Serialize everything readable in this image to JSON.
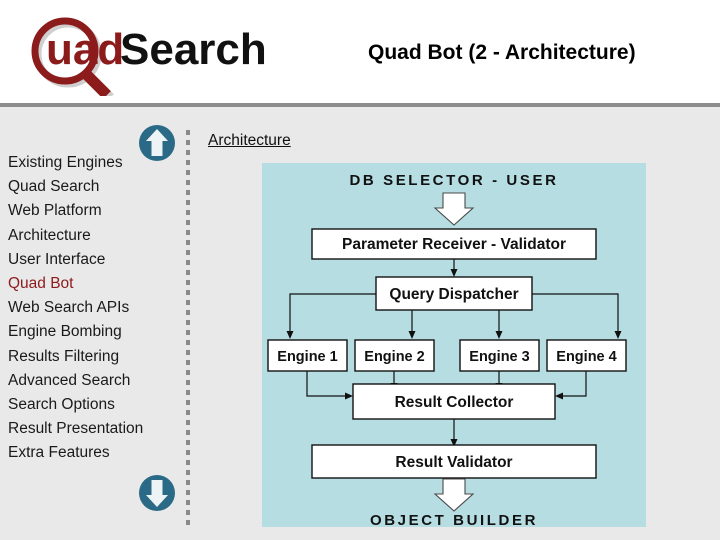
{
  "header": {
    "logo": {
      "icon": "magnifier-q-icon",
      "text_accent": "uad",
      "text_main": "Search",
      "accent_color": "#8c1b1b",
      "main_color": "#111111"
    },
    "title": "Quad Bot (2 - Architecture)"
  },
  "sidebar": {
    "scroll_up_icon": "circle-up-arrow-icon",
    "scroll_down_icon": "circle-down-arrow-icon",
    "accent_color": "#2a6a86",
    "active_color": "#8c1b1b",
    "items": [
      {
        "label": "Existing Engines",
        "active": false
      },
      {
        "label": "Quad Search",
        "active": false
      },
      {
        "label": "Web Platform",
        "active": false
      },
      {
        "label": "Architecture",
        "active": false
      },
      {
        "label": "User Interface",
        "active": false
      },
      {
        "label": "Quad Bot",
        "active": true
      },
      {
        "label": "Web Search APIs",
        "active": false
      },
      {
        "label": "Engine Bombing",
        "active": false
      },
      {
        "label": "Results Filtering",
        "active": false
      },
      {
        "label": "Advanced Search",
        "active": false
      },
      {
        "label": "Search Options",
        "active": false
      },
      {
        "label": "Result Presentation",
        "active": false
      },
      {
        "label": "Extra Features",
        "active": false
      }
    ]
  },
  "main": {
    "section_heading": "Architecture",
    "diagram": {
      "background_color": "#b6dde2",
      "top_caption": "DB SELECTOR - USER",
      "bottom_caption": "OBJECT BUILDER",
      "boxes": [
        {
          "id": "parameter-receiver",
          "label": "Parameter Receiver - Validator"
        },
        {
          "id": "query-dispatcher",
          "label": "Query Dispatcher"
        },
        {
          "id": "engine-1",
          "label": "Engine 1"
        },
        {
          "id": "engine-2",
          "label": "Engine 2"
        },
        {
          "id": "engine-3",
          "label": "Engine 3"
        },
        {
          "id": "engine-4",
          "label": "Engine 4"
        },
        {
          "id": "result-collector",
          "label": "Result Collector"
        },
        {
          "id": "result-validator",
          "label": "Result Validator"
        }
      ]
    }
  }
}
